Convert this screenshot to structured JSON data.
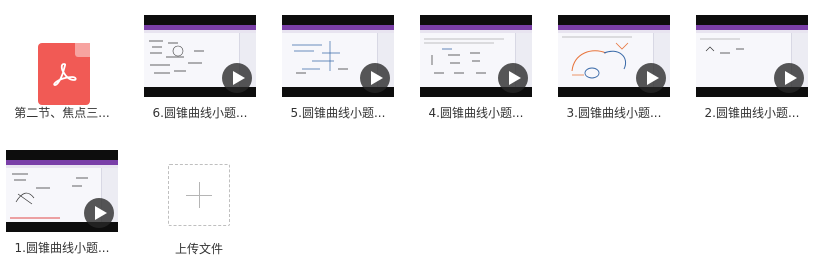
{
  "files": [
    {
      "name": "第二节、焦点三...",
      "kind": "pdf",
      "icon": "pdf-icon"
    },
    {
      "name": "6.圆锥曲线小题...",
      "kind": "video"
    },
    {
      "name": "5.圆锥曲线小题...",
      "kind": "video"
    },
    {
      "name": "4.圆锥曲线小题...",
      "kind": "video"
    },
    {
      "name": "3.圆锥曲线小题...",
      "kind": "video"
    },
    {
      "name": "2.圆锥曲线小题...",
      "kind": "video"
    },
    {
      "name": "1.圆锥曲线小题...",
      "kind": "video"
    }
  ],
  "upload": {
    "label": "上传文件",
    "icon": "plus-icon"
  },
  "colors": {
    "pdf": "#f15a55",
    "onenote_bar": "#7a3fa8",
    "play_button": "#2b2b2b"
  }
}
